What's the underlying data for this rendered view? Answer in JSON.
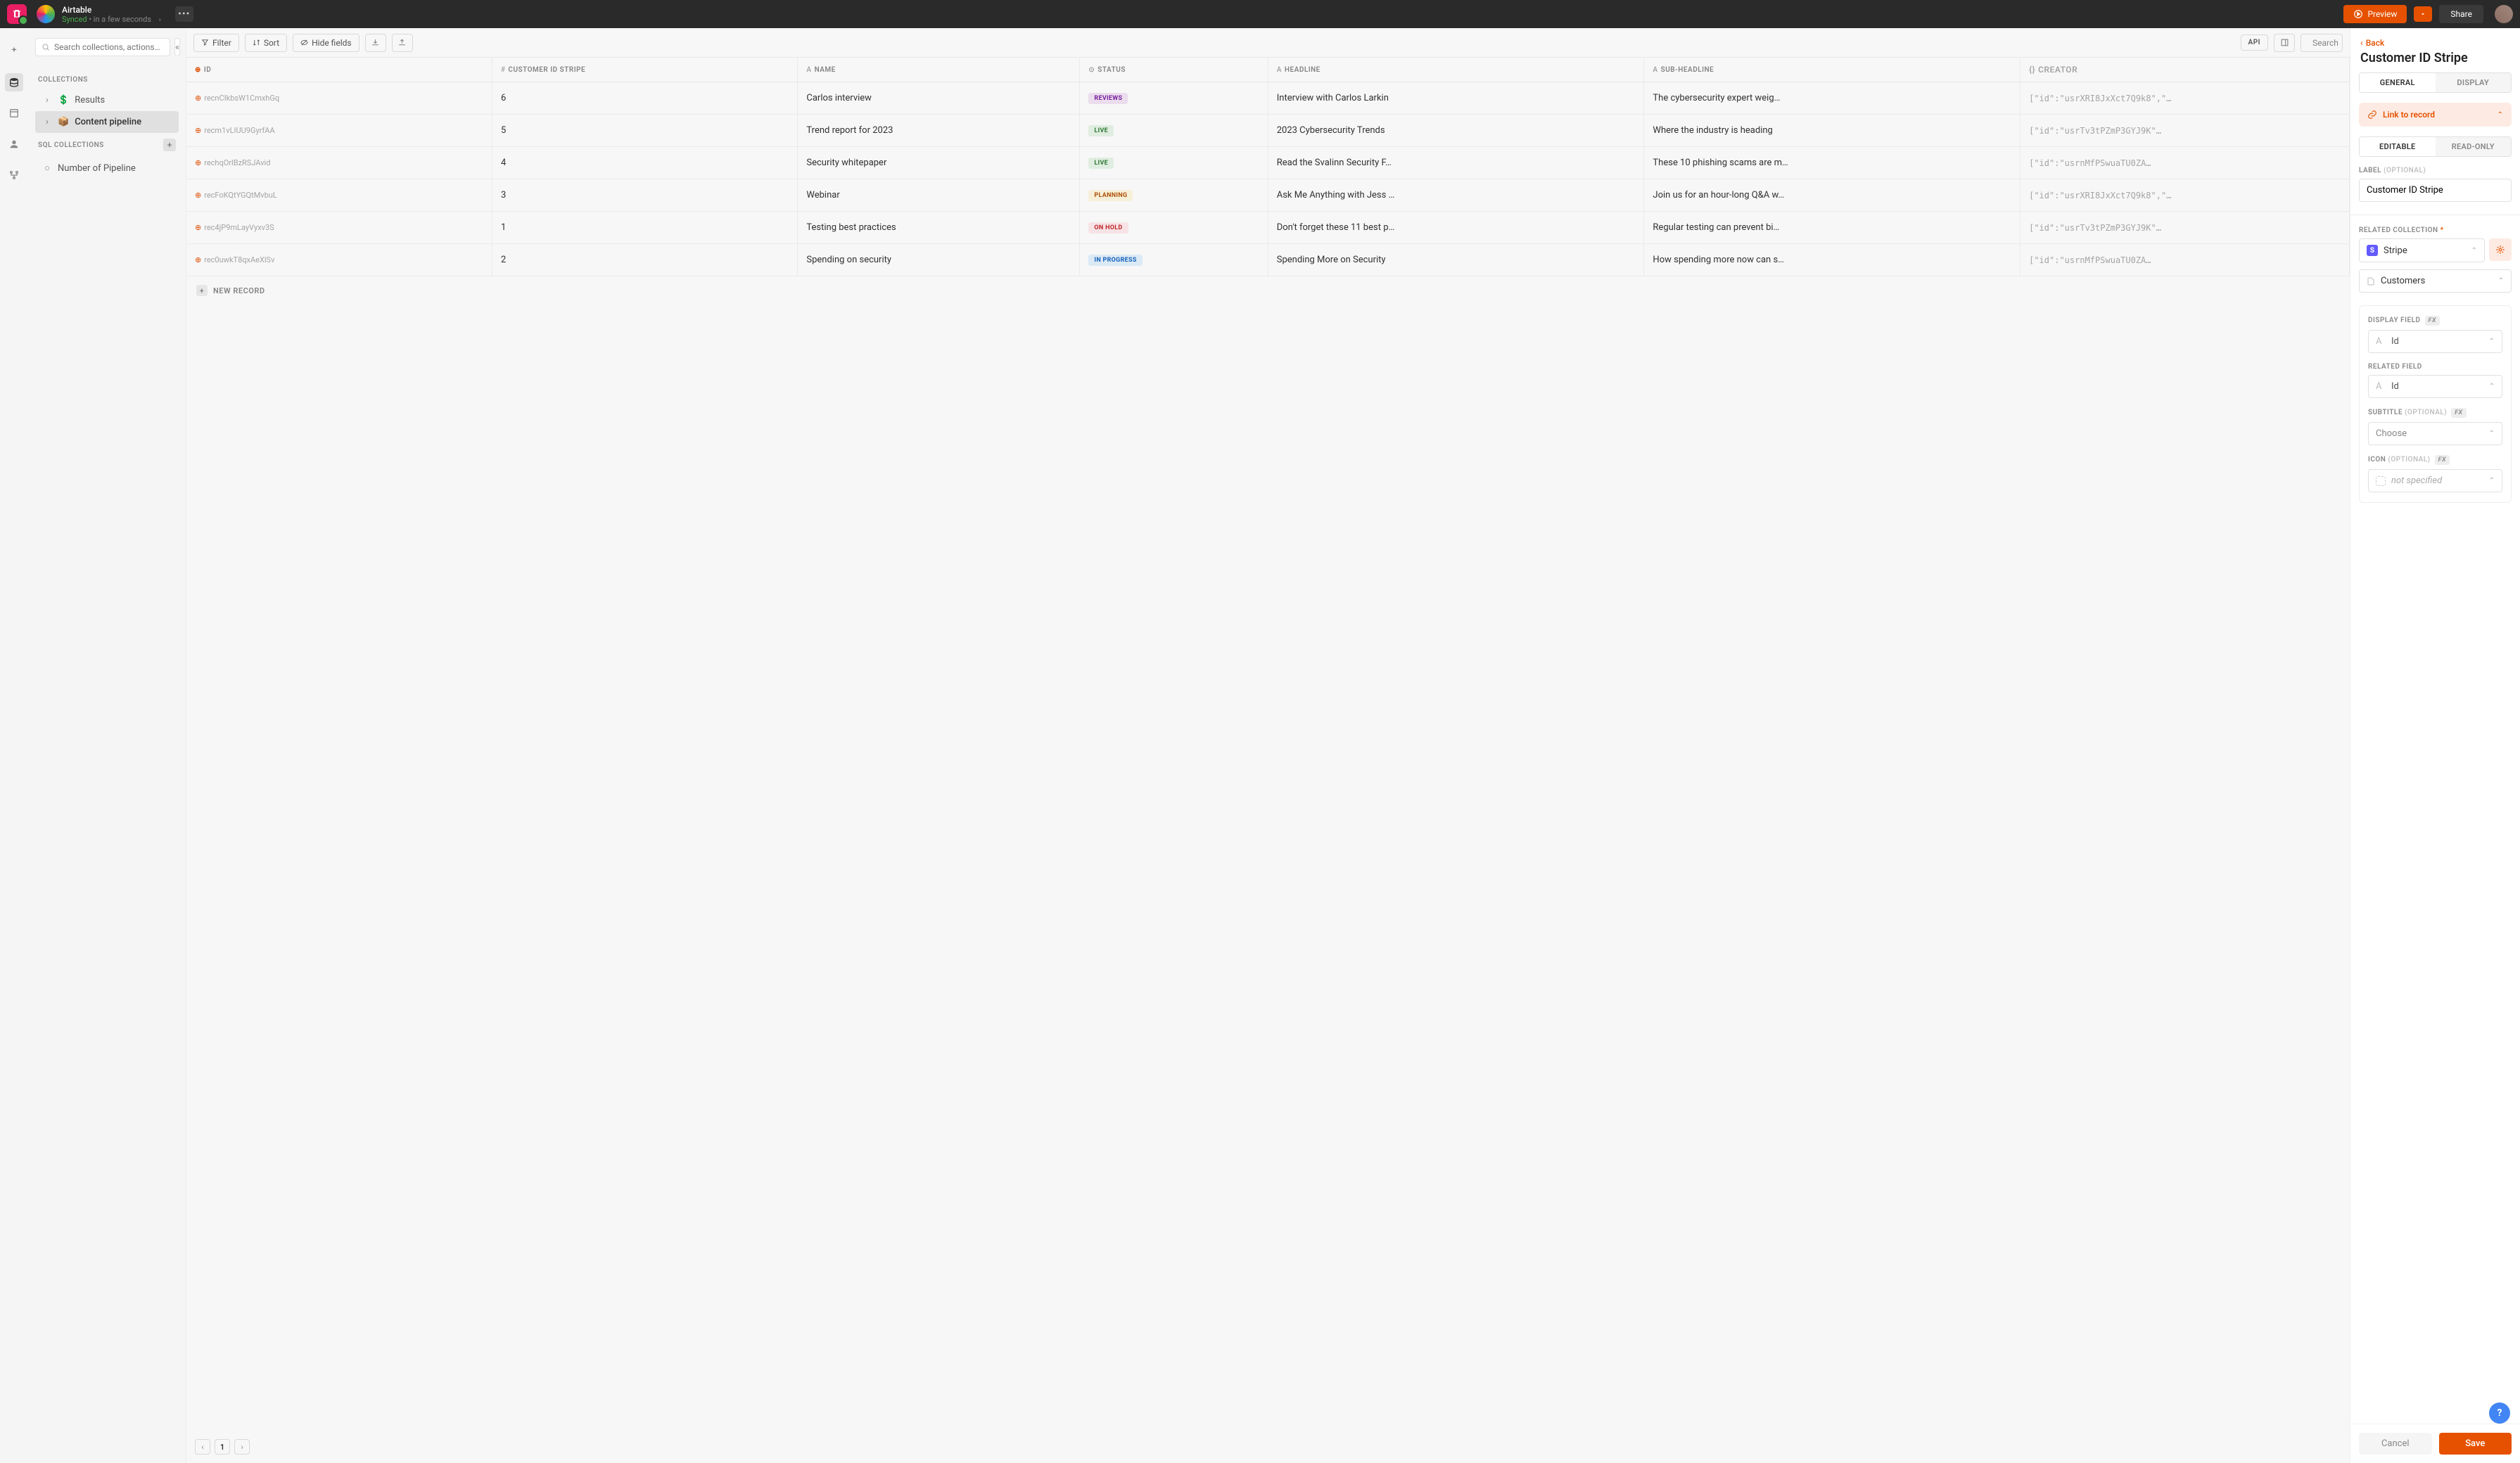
{
  "header": {
    "project_name": "Airtable",
    "synced_label": "Synced",
    "sync_time": "• in a few seconds",
    "preview_label": "Preview",
    "share_label": "Share"
  },
  "sidebar": {
    "search_placeholder": "Search collections, actions…",
    "sections": {
      "collections_title": "Collections",
      "sql_title": "SQL Collections"
    },
    "collections": [
      {
        "label": "Results",
        "icon": "dollar"
      },
      {
        "label": "Content pipeline",
        "icon": "box",
        "active": true
      }
    ],
    "sql_collections": [
      {
        "label": "Number of Pipeline",
        "icon": "circle"
      }
    ]
  },
  "toolbar": {
    "filter": "Filter",
    "sort": "Sort",
    "hide_fields": "Hide fields",
    "api": "API",
    "search_placeholder": "Search"
  },
  "columns": [
    "ID",
    "Customer ID Stripe",
    "Name",
    "Status",
    "Headline",
    "Sub-headline",
    "Creator"
  ],
  "rows": [
    {
      "id": "recnCIkbsW1CmxhGq",
      "num": "6",
      "name": "Carlos interview",
      "status": "REVIEWS",
      "status_class": "b-reviews",
      "headline": "Interview with Carlos Larkin",
      "sub": "The cybersecurity expert weig…",
      "creator": "[\"id\":\"usrXRI8JxXct7Q9k8\",\"…"
    },
    {
      "id": "recm1vLIUU9GyrfAA",
      "num": "5",
      "name": "Trend report for 2023",
      "status": "LIVE",
      "status_class": "b-live",
      "headline": "2023 Cybersecurity Trends",
      "sub": "Where the industry is heading",
      "creator": "[\"id\":\"usrTv3tPZmP3GYJ9K\"…"
    },
    {
      "id": "rechqOrlBzRSJAvid",
      "num": "4",
      "name": "Security whitepaper",
      "status": "LIVE",
      "status_class": "b-live",
      "headline": "Read the Svalinn Security F…",
      "sub": "These 10 phishing scams are m…",
      "creator": "[\"id\":\"usrnMfPSwuaTU0ZA…"
    },
    {
      "id": "recFoKQtYGQtMvbuL",
      "num": "3",
      "name": "Webinar",
      "status": "PLANNING",
      "status_class": "b-planning",
      "headline": "Ask Me Anything with Jess …",
      "sub": "Join us for an hour-long Q&A w…",
      "creator": "[\"id\":\"usrXRI8JxXct7Q9k8\",\"…"
    },
    {
      "id": "rec4jP9mLayVyxv3S",
      "num": "1",
      "name": "Testing best practices",
      "status": "ON HOLD",
      "status_class": "b-onhold",
      "headline": "Don't forget these 11 best p…",
      "sub": "Regular testing can prevent bi…",
      "creator": "[\"id\":\"usrTv3tPZmP3GYJ9K\"…"
    },
    {
      "id": "rec0uwkT8qxAeXlSv",
      "num": "2",
      "name": "Spending on security",
      "status": "IN PROGRESS",
      "status_class": "b-inprogress",
      "headline": "Spending More on Security",
      "sub": "How spending more now can s…",
      "creator": "[\"id\":\"usrnMfPSwuaTU0ZA…"
    }
  ],
  "new_record_label": "NEW RECORD",
  "pagination": {
    "current": "1"
  },
  "panel": {
    "back_label": "Back",
    "title": "Customer ID Stripe",
    "tabs_main": {
      "general": "GENERAL",
      "display": "DISPLAY"
    },
    "link_record": "Link to record",
    "tabs_edit": {
      "editable": "EDITABLE",
      "readonly": "READ-ONLY"
    },
    "label_field": {
      "title": "Label",
      "optional": "(optional)",
      "value": "Customer ID Stripe"
    },
    "related_collection": {
      "title": "Related Collection",
      "value1": "Stripe",
      "value2": "Customers"
    },
    "display_field": {
      "title": "Display Field",
      "value": "Id"
    },
    "related_field": {
      "title": "Related Field",
      "value": "Id"
    },
    "subtitle": {
      "title": "Subtitle",
      "optional": "(optional)",
      "placeholder": "Choose"
    },
    "icon": {
      "title": "Icon",
      "optional": "(optional)",
      "placeholder": "not specified"
    },
    "cancel": "Cancel",
    "save": "Save"
  }
}
